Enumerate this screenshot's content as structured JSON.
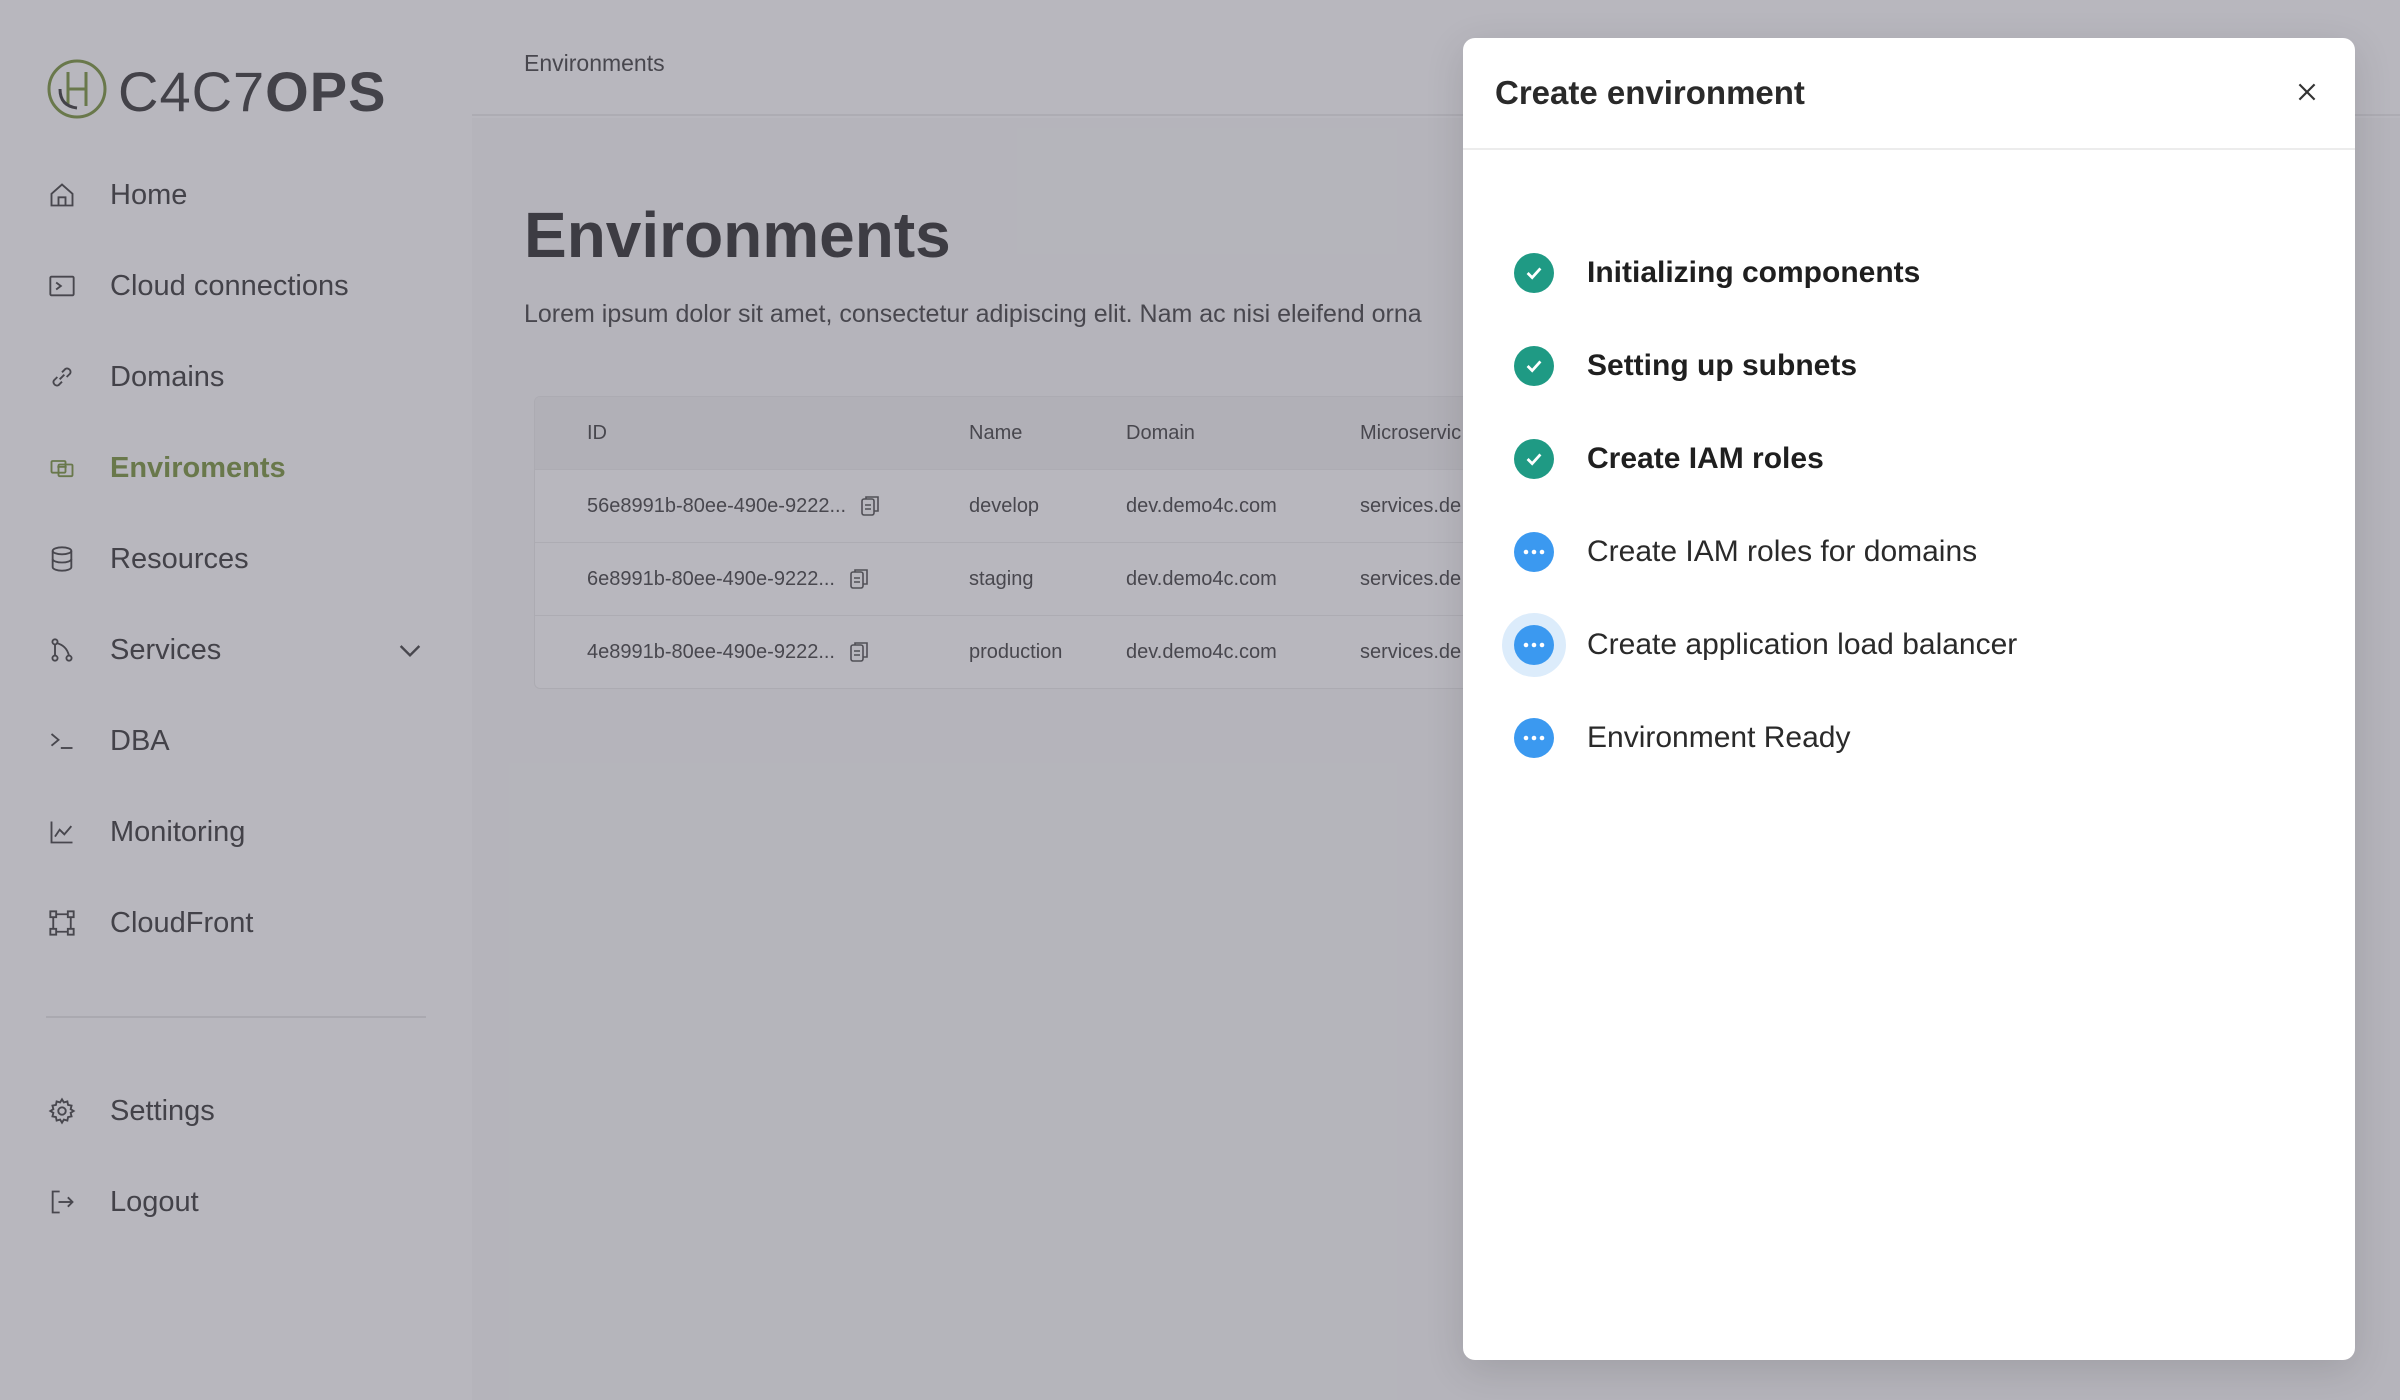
{
  "brand": {
    "logo_text_light": "C4C7",
    "logo_text_bold": "OPS",
    "accent": "#6f8c2f"
  },
  "sidebar": {
    "items": [
      {
        "label": "Home",
        "icon": "home-icon"
      },
      {
        "label": "Cloud connections",
        "icon": "terminal-box-icon"
      },
      {
        "label": "Domains",
        "icon": "link-icon"
      },
      {
        "label": "Enviroments",
        "icon": "switch-icon",
        "active": true
      },
      {
        "label": "Resources",
        "icon": "database-icon"
      },
      {
        "label": "Services",
        "icon": "git-branch-icon",
        "expandable": true
      },
      {
        "label": "DBA",
        "icon": "prompt-icon"
      },
      {
        "label": "Monitoring",
        "icon": "line-chart-icon"
      },
      {
        "label": "CloudFront",
        "icon": "nodes-icon"
      }
    ],
    "footer": [
      {
        "label": "Settings",
        "icon": "gear-icon"
      },
      {
        "label": "Logout",
        "icon": "logout-icon"
      }
    ]
  },
  "header": {
    "breadcrumb": "Environments"
  },
  "main": {
    "title": "Environments",
    "description": "Lorem ipsum dolor sit amet, consectetur adipiscing elit. Nam ac nisi eleifend orna",
    "table": {
      "columns": [
        "ID",
        "Name",
        "Domain",
        "Microservic"
      ],
      "rows": [
        {
          "id": "56e8991b-80ee-490e-9222...",
          "name": "develop",
          "domain": "dev.demo4c.com",
          "microservices": "services.de"
        },
        {
          "id": "6e8991b-80ee-490e-9222...",
          "name": "staging",
          "domain": "dev.demo4c.com",
          "microservices": "services.de"
        },
        {
          "id": "4e8991b-80ee-490e-9222...",
          "name": "production",
          "domain": "dev.demo4c.com",
          "microservices": "services.de"
        }
      ]
    }
  },
  "drawer": {
    "title": "Create environment",
    "close_icon": "close-icon",
    "colors": {
      "done": "#1f9a84",
      "pending": "#3b99f0",
      "halo": "#dcecfb"
    },
    "steps": [
      {
        "label": "Initializing components",
        "status": "done"
      },
      {
        "label": "Setting up subnets",
        "status": "done"
      },
      {
        "label": "Create IAM roles",
        "status": "done"
      },
      {
        "label": "Create IAM roles for domains",
        "status": "pending"
      },
      {
        "label": "Create application load balancer",
        "status": "in-progress"
      },
      {
        "label": "Environment Ready",
        "status": "pending"
      }
    ]
  }
}
